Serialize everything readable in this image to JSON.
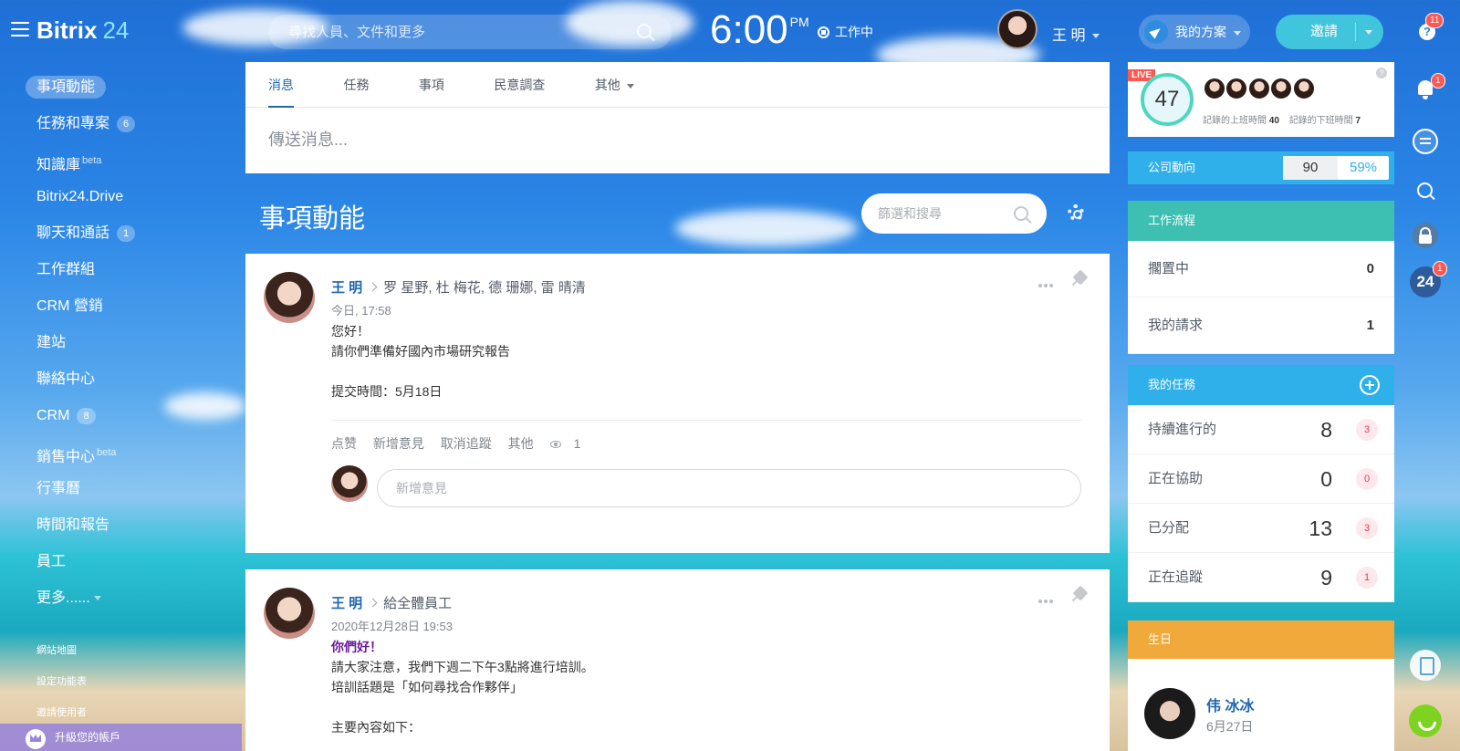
{
  "topbar": {
    "logo_main": "Bitrix",
    "logo_num": "24",
    "search_placeholder": "尋找人員、文件和更多",
    "time": "6:00",
    "ampm": "PM",
    "work_status": "工作中",
    "user_name": "王 明",
    "plan_label": "我的方案",
    "invite_label": "邀請",
    "notify_count": "11"
  },
  "sidebar": {
    "items": [
      {
        "label": "事項動能",
        "active": true
      },
      {
        "label": "任務和專案",
        "count": "6"
      },
      {
        "label": "知識庫",
        "beta": "beta"
      },
      {
        "label": "Bitrix24.Drive"
      },
      {
        "label": "聊天和通話",
        "count": "1"
      },
      {
        "label": "工作群組"
      },
      {
        "label": "CRM 營銷"
      },
      {
        "label": "建站"
      },
      {
        "label": "聯絡中心"
      },
      {
        "label": "CRM",
        "count": "8"
      },
      {
        "label": "銷售中心",
        "beta": "beta"
      },
      {
        "label": "行事曆"
      },
      {
        "label": "時間和報告"
      },
      {
        "label": "員工"
      },
      {
        "label": "更多......"
      }
    ],
    "small_links": [
      "網站地圖",
      "設定功能表",
      "邀請使用者"
    ],
    "upgrade_label": "升級您的帳戶"
  },
  "composer": {
    "tabs": [
      "消息",
      "任務",
      "事項",
      "民意調查",
      "其他"
    ],
    "placeholder": "傳送消息..."
  },
  "feed": {
    "title": "事項動能",
    "filter_placeholder": "篩選和搜尋"
  },
  "posts": [
    {
      "author": "王 明",
      "recipients": "罗 星野, 杜 梅花, 德 珊娜, 雷 晴清",
      "time": "今日, 17:58",
      "lines": [
        "您好！",
        "請你們準備好國內市場研究報告",
        "",
        "提交時間：5月18日"
      ],
      "actions": [
        "点赞",
        "新增意見",
        "取消追蹤",
        "其他"
      ],
      "views": "1",
      "comment_placeholder": "新增意見"
    },
    {
      "author": "王 明",
      "recipients": "給全體員工",
      "time": "2020年12月28日 19:53",
      "greeting": "你們好！",
      "lines": [
        "請大家注意，我們下週二下午3點將進行培訓。",
        "培訓話題是「如何尋找合作夥伴」",
        "",
        "主要內容如下："
      ]
    }
  ],
  "live": {
    "badge": "LIVE",
    "count": "47",
    "checked_in_label": "記錄的上班時間",
    "checked_in": "40",
    "checked_out_label": "記錄的下班時間",
    "checked_out": "7"
  },
  "pulse": {
    "label": "公司動向",
    "value": "90",
    "percent": "59%"
  },
  "workflow": {
    "title": "工作流程",
    "rows": [
      {
        "label": "擱置中",
        "value": "0"
      },
      {
        "label": "我的請求",
        "value": "1"
      }
    ]
  },
  "tasks": {
    "title": "我的任務",
    "rows": [
      {
        "label": "持續進行的",
        "value": "8",
        "badge": "3"
      },
      {
        "label": "正在協助",
        "value": "0",
        "badge": "0"
      },
      {
        "label": "已分配",
        "value": "13",
        "badge": "3"
      },
      {
        "label": "正在追蹤",
        "value": "9",
        "badge": "1"
      }
    ]
  },
  "birthday": {
    "title": "生日",
    "name": "伟 冰冰",
    "date": "6月27日"
  },
  "rightbar": {
    "bell_count": "1",
    "b24_label": "24",
    "b24_count": "1"
  },
  "colors": {
    "accent_blue": "#2067b0",
    "workflow_teal": "#3dbfb2",
    "tasks_blue": "#2fb0ea",
    "birthday_orange": "#f0a93a",
    "badge_red": "#ff5752"
  }
}
